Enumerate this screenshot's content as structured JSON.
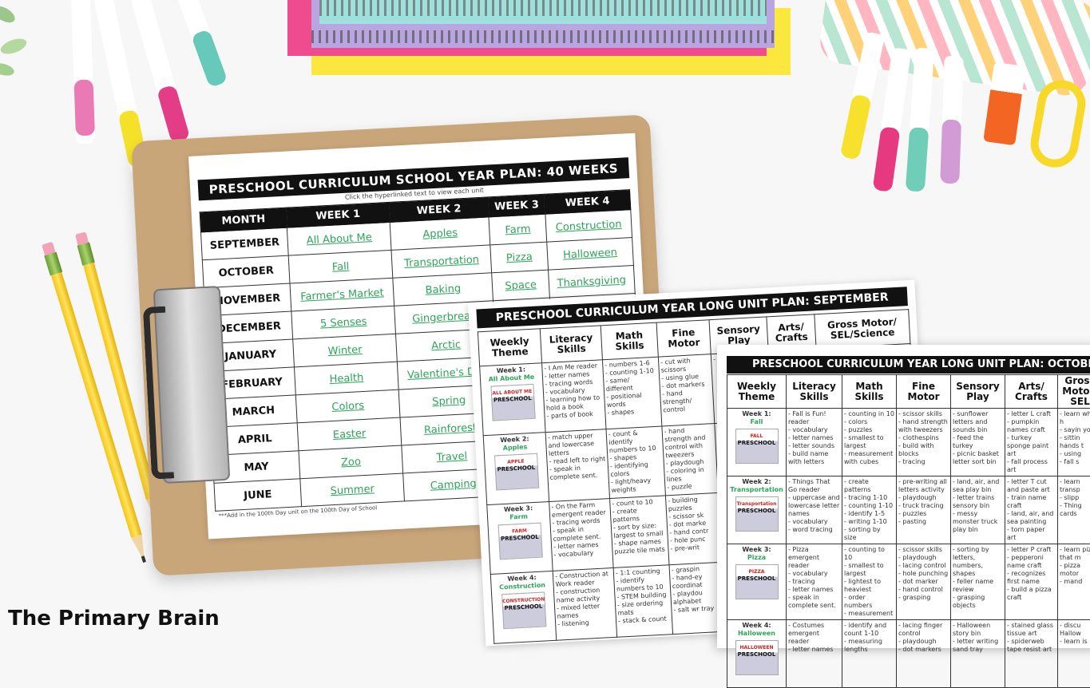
{
  "brand": "The Primary Brain",
  "year_plan": {
    "title": "PRESCHOOL CURRICULUM SCHOOL YEAR PLAN: 40 WEEKS OF THEMES",
    "subtitle": "Click the hyperlinked text to view each unit",
    "headers": [
      "MONTH",
      "WEEK 1",
      "WEEK 2",
      "WEEK 3",
      "WEEK 4"
    ],
    "rows": [
      [
        "SEPTEMBER",
        "All About Me",
        "Apples",
        "Farm",
        "Construction"
      ],
      [
        "OCTOBER",
        "Fall",
        "Transportation",
        "Pizza",
        "Halloween"
      ],
      [
        "NOVEMBER",
        "Farmer's Market",
        "Baking",
        "Space",
        "Thanksgiving"
      ],
      [
        "DECEMBER",
        "5 Senses",
        "Gingerbread",
        "",
        ""
      ],
      [
        "JANUARY",
        "Winter",
        "Arctic",
        "",
        ""
      ],
      [
        "FEBRUARY",
        "Health",
        "Valentine's Day",
        "",
        ""
      ],
      [
        "MARCH",
        "Colors",
        "Spring",
        "",
        ""
      ],
      [
        "APRIL",
        "Easter",
        "Rainforest",
        "",
        ""
      ],
      [
        "MAY",
        "Zoo",
        "Travel",
        "",
        ""
      ],
      [
        "JUNE",
        "Summer",
        "Camping",
        "",
        ""
      ]
    ],
    "footnote": "***Add in the 100th Day unit on the 100th Day of School"
  },
  "september_plan": {
    "title": "PRESCHOOL CURRICULUM YEAR LONG UNIT PLAN: SEPTEMBER",
    "headers": [
      "Weekly Theme",
      "Literacy Skills",
      "Math Skills",
      "Fine Motor",
      "Sensory Play",
      "Arts/ Crafts",
      "Gross Motor/ SEL/Science"
    ],
    "weeks": [
      {
        "week": "Week 1:",
        "theme": "All About Me",
        "book": "ALL ABOUT ME",
        "literacy": "- I Am Me reader\n- letter names\n- tracing words\n- vocabulary\n- learning how to hold a book\n- parts of book",
        "math": "- numbers 1-6\n- counting 1-10\n- same/ different\n- positional words\n- shapes",
        "fine": "- cut with scissors\n- using glue\n- dot markers\n- hand strength/ control",
        "sensory": "- imaginative",
        "arts": "- name craft\n- identify first",
        "gross": "- learn about what we use our body to do\n- learn about parts of"
      },
      {
        "week": "Week 2:",
        "theme": "Apples",
        "book": "APPLE",
        "literacy": "- match upper and lowercase letters\n- read left to right\n- speak in complete sent.",
        "math": "- count & identify numbers to 10\n- shapes\n- identifying colors\n- light/heavy weights",
        "fine": "- hand strength and control with tweezers\n- playdough\n- coloring in lines\n- puzzle",
        "sensory": "",
        "arts": "",
        "gross": ""
      },
      {
        "week": "Week 3:",
        "theme": "Farm",
        "book": "FARM",
        "literacy": "- On the Farm emergent reader\n- tracing words\n- speak in complete sent.\n- letter names\n- vocabulary",
        "math": "- count to 10\n- create patterns\n- sort by size: largest to small\n- shape names puzzle tile mats",
        "fine": "- building puzzles\n- scissor sk\n- dot marke\n- hand contr\n- hole punc\n- pre-writ",
        "sensory": "",
        "arts": "",
        "gross": ""
      },
      {
        "week": "Week 4:",
        "theme": "Construction",
        "book": "CONSTRUCTION",
        "literacy": "- Construction at Work reader\n- construction name activity\n- mixed letter names\n- listening",
        "math": "- 1:1 counting\n- identify numbers to 10\n- STEM building\n- size ordering mats\n- stack & count",
        "fine": "- graspin\n- hand-ey coordinat\n- playdou alphabet\n- salt wr tray",
        "sensory": "",
        "arts": "",
        "gross": ""
      }
    ]
  },
  "october_plan": {
    "title": "PRESCHOOL CURRICULUM YEAR LONG UNIT PLAN: OCTOBER",
    "headers": [
      "Weekly Theme",
      "Literacy Skills",
      "Math Skills",
      "Fine Motor",
      "Sensory Play",
      "Arts/ Crafts",
      "Gross Motor/ SEL"
    ],
    "weeks": [
      {
        "week": "Week 1:",
        "theme": "Fall",
        "book": "FALL",
        "literacy": "- Fall is Fun! reader\n- vocabulary\n- letter names\n- letter sounds\n- build name with letters",
        "math": "- counting in 10\n- colors\n- puzzles\n- smallest to largest\n- measurement with cubes",
        "fine": "- scissor skills\n- hand strength with tweezers\n- clothespins\n- build with blocks\n- tracing",
        "sensory": "- sunflower letters and sounds bin\n- feed the turkey\n- picnic basket letter sort bin",
        "arts": "- letter L craft\n- pumpkin names craft\n- turkey sponge paint art\n- fall process art",
        "gross": "- learn what h\n- sayin you\n- sittin hands t\n- using\n- fall s"
      },
      {
        "week": "Week 2:",
        "theme": "Transportation",
        "book": "Transportation",
        "literacy": "- Things That Go reader\n- uppercase and lowercase letter names\n- vocabulary\n- word tracing",
        "math": "- create patterns\n- tracing 1-10\n- counting 1-10\n- identify 1-5\n- writing 1-10\n- sorting by size",
        "fine": "- pre-writing all letters activity\n- playdough\n- truck tracing\n- puzzles\n- pasting",
        "sensory": "- land, air, and sea play bin\n- letter trains sensory bin\n- messy monster truck play bin",
        "arts": "- letter T cut and paste art\n- train name craft\n- land, air, and sea painting\n- torn paper art",
        "gross": "- learn transp\n- slipp\n- Thing cards"
      },
      {
        "week": "Week 3:",
        "theme": "Pizza",
        "book": "PIZZA",
        "literacy": "- Pizza emergent reader\n- vocabulary\n- tracing\n- letter names\n- speak in complete sent.",
        "math": "- counting to 10\n- smallest to largest\n- lightest to heaviest\n- order numbers\n- measurement",
        "fine": "- scissor skills\n- playdough\n- lacing control\n- hole punching\n- dot marker\n- hand control\n- grasping",
        "sensory": "- sorting by letters, numbers, shapes\n- feller name review\n- grasping objects",
        "arts": "- letter P craft\n- pepperoni name craft\n- recognizes first name\n- build a pizza craft",
        "gross": "- learn pizza that m\n- pizza motor\n- mand"
      },
      {
        "week": "Week 4:",
        "theme": "Halloween",
        "book": "HALLOWEEN",
        "literacy": "- Costumes emergent reader\n- letter names",
        "math": "- identify and count 1-10\n- measuring lengths",
        "fine": "- lacing finger control\n- playdough\n- dot markers",
        "sensory": "- Halloween story bin\n- letter writing sand tray",
        "arts": "- stained glass tissue art\n- spiderweb tape resist art",
        "gross": "- discu Hallow\n- learn is"
      }
    ]
  },
  "colors": {
    "link_green": "#2ea55a",
    "header_black": "#111111"
  }
}
